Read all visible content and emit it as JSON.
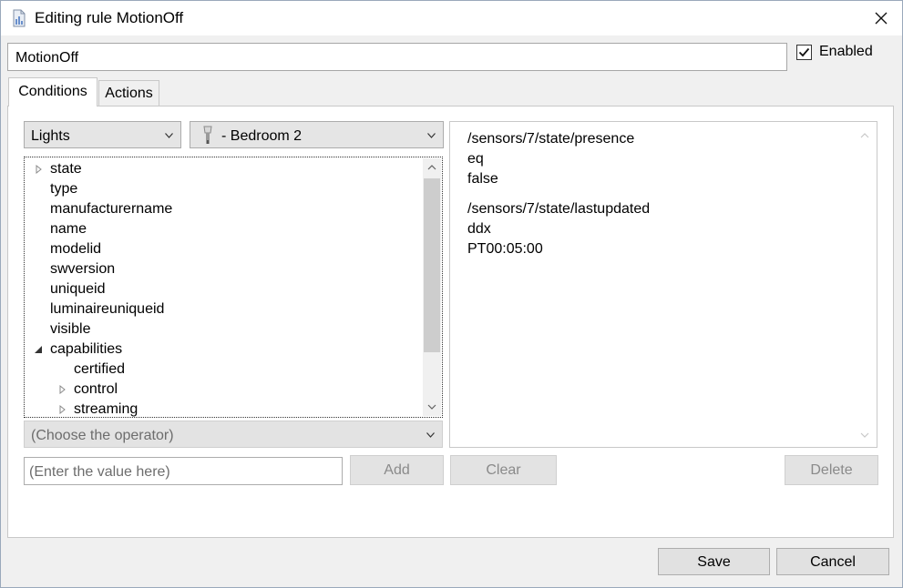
{
  "window": {
    "title": "Editing rule MotionOff",
    "icon": "rule-editor-icon",
    "close_icon": "close-icon"
  },
  "rule": {
    "name": "MotionOff",
    "enabled_label": "Enabled",
    "enabled": true
  },
  "tabs": [
    {
      "label": "Conditions",
      "active": true
    },
    {
      "label": "Actions",
      "active": false
    }
  ],
  "conditions": {
    "device_type_select": "Lights",
    "device_select": "- Bedroom 2",
    "device_icon": "lightbulb-icon",
    "tree": [
      {
        "label": "state",
        "expander": "collapsed",
        "level": 0
      },
      {
        "label": "type",
        "expander": "none",
        "level": 0
      },
      {
        "label": "manufacturername",
        "expander": "none",
        "level": 0
      },
      {
        "label": "name",
        "expander": "none",
        "level": 0
      },
      {
        "label": "modelid",
        "expander": "none",
        "level": 0
      },
      {
        "label": "swversion",
        "expander": "none",
        "level": 0
      },
      {
        "label": "uniqueid",
        "expander": "none",
        "level": 0
      },
      {
        "label": "luminaireuniqueid",
        "expander": "none",
        "level": 0
      },
      {
        "label": "visible",
        "expander": "none",
        "level": 0
      },
      {
        "label": "capabilities",
        "expander": "expanded",
        "level": 0
      },
      {
        "label": "certified",
        "expander": "none",
        "level": 1
      },
      {
        "label": "control",
        "expander": "collapsed",
        "level": 1
      },
      {
        "label": "streaming",
        "expander": "collapsed",
        "level": 1
      }
    ],
    "operator_placeholder": "(Choose the operator)",
    "value_placeholder": "(Enter the value here)",
    "add_label": "Add",
    "clear_label": "Clear",
    "delete_label": "Delete",
    "list": [
      {
        "address": "/sensors/7/state/presence",
        "operator": "eq",
        "value": "false"
      },
      {
        "address": "/sensors/7/state/lastupdated",
        "operator": "ddx",
        "value": "PT00:05:00"
      }
    ]
  },
  "footer": {
    "save_label": "Save",
    "cancel_label": "Cancel"
  }
}
